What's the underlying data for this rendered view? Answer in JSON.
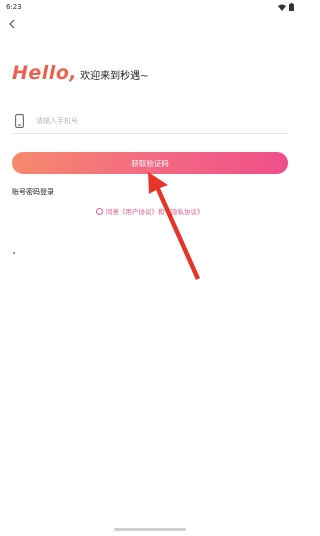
{
  "status_bar": {
    "time": "6:23"
  },
  "greeting": {
    "hello": "Hello,",
    "welcome": "欢迎来到秒遇~"
  },
  "login": {
    "phone_placeholder": "请输入手机号",
    "get_code_label": "获取验证码",
    "password_login_label": "账号密码登录",
    "agreement_text": "同意《用户协议》和《隐私协议》"
  },
  "colors": {
    "hello": "#f0604f",
    "button_gradient_start": "#f6896d",
    "button_gradient_end": "#ef4f8a",
    "accent_pink": "#e85a8a",
    "arrow_red": "#e8332a"
  },
  "icons": {
    "back": "chevron-left-icon",
    "phone": "mobile-phone-icon",
    "wifi": "wifi-icon",
    "battery": "battery-icon"
  }
}
